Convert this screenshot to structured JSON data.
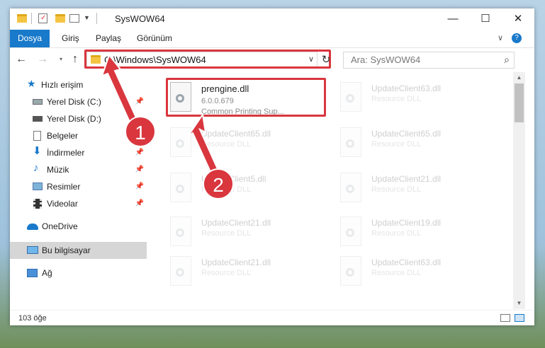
{
  "window": {
    "title": "SysWOW64",
    "controls": {
      "minimize": "—",
      "maximize": "☐",
      "close": "✕"
    }
  },
  "ribbon": {
    "tabs": [
      "Dosya",
      "Giriş",
      "Paylaş",
      "Görünüm"
    ],
    "collapse": "∨",
    "help": "?"
  },
  "address": {
    "path": "C:\\Windows\\SysWOW64",
    "search_placeholder": "Ara: SysWOW64"
  },
  "sidebar": {
    "items": [
      {
        "label": "Hızlı erişim",
        "icon": "star-icon",
        "pinned": false
      },
      {
        "label": "Yerel Disk (C:)",
        "icon": "drive-icon",
        "pinned": true
      },
      {
        "label": "Yerel Disk (D:)",
        "icon": "drive-icon",
        "pinned": false
      },
      {
        "label": "Belgeler",
        "icon": "documents-icon",
        "pinned": false
      },
      {
        "label": "İndirmeler",
        "icon": "download-icon",
        "pinned": true
      },
      {
        "label": "Müzik",
        "icon": "music-icon",
        "pinned": true
      },
      {
        "label": "Resimler",
        "icon": "pictures-icon",
        "pinned": true
      },
      {
        "label": "Videolar",
        "icon": "video-icon",
        "pinned": true
      },
      {
        "label": "OneDrive",
        "icon": "cloud-icon",
        "pinned": false
      },
      {
        "label": "Bu bilgisayar",
        "icon": "computer-icon",
        "pinned": false
      },
      {
        "label": "Ağ",
        "icon": "network-icon",
        "pinned": false
      }
    ]
  },
  "files": {
    "highlighted": {
      "name": "prengine.dll",
      "version": "6.0.0.679",
      "description": "Common Printing Sup..."
    },
    "faded": [
      {
        "name": "UpdateClient63.dll",
        "type": "Resource DLL"
      },
      {
        "name": "UpdateClient65.dll",
        "type": "Resource DLL"
      },
      {
        "name": "UpdateClient65.dll",
        "type": "Resource DLL"
      },
      {
        "name": "UpdateClient5.dll",
        "type": "Resource DLL"
      },
      {
        "name": "UpdateClient21.dll",
        "type": "Resource DLL"
      },
      {
        "name": "UpdateClient21.dll",
        "type": "Resource DLL"
      },
      {
        "name": "UpdateClient19.dll",
        "type": "Resource DLL"
      },
      {
        "name": "UpdateClient21.dll",
        "type": "Resource DLL"
      },
      {
        "name": "UpdateClient63.dll",
        "type": "Resource DLL"
      }
    ]
  },
  "status": {
    "count": "103 öğe"
  },
  "callouts": {
    "one": "1",
    "two": "2"
  },
  "colors": {
    "accent": "#1979ca",
    "highlight": "#d9363e"
  }
}
